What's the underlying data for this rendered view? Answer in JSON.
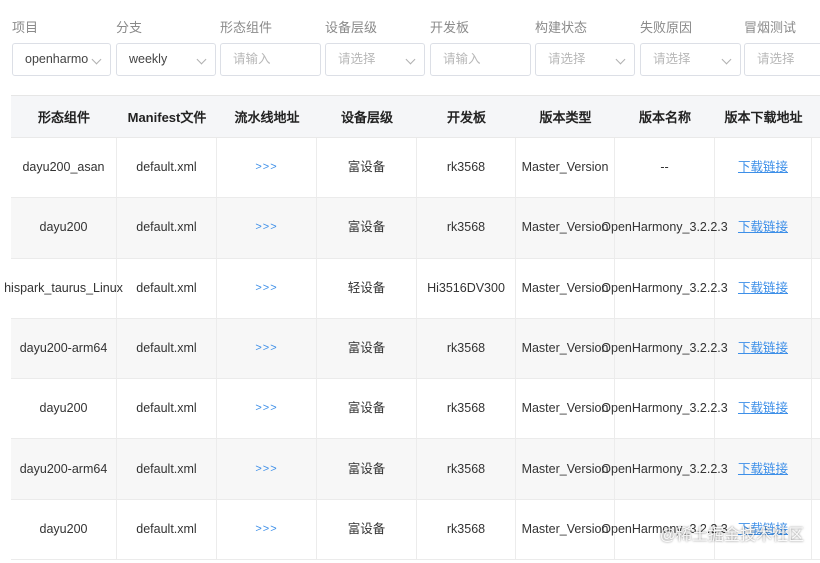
{
  "filters": [
    {
      "label": "项目",
      "value": "openharmo",
      "placeholder": "",
      "chevron": true
    },
    {
      "label": "分支",
      "value": "weekly",
      "placeholder": "",
      "chevron": true
    },
    {
      "label": "形态组件",
      "value": "",
      "placeholder": "请输入",
      "chevron": false
    },
    {
      "label": "设备层级",
      "value": "",
      "placeholder": "请选择",
      "chevron": true
    },
    {
      "label": "开发板",
      "value": "",
      "placeholder": "请输入",
      "chevron": false
    },
    {
      "label": "构建状态",
      "value": "",
      "placeholder": "请选择",
      "chevron": true
    },
    {
      "label": "失败原因",
      "value": "",
      "placeholder": "请选择",
      "chevron": true
    },
    {
      "label": "冒烟测试",
      "value": "",
      "placeholder": "请选择",
      "chevron": false
    }
  ],
  "table": {
    "headers": [
      "形态组件",
      "Manifest文件",
      "流水线地址",
      "设备层级",
      "开发板",
      "版本类型",
      "版本名称",
      "版本下载地址"
    ],
    "pipeline_link": ">>>",
    "download_link": "下载链接",
    "rows": [
      {
        "component": "dayu200_asan",
        "manifest": "default.xml",
        "level": "富设备",
        "board": "rk3568",
        "type": "Master_Version",
        "name": "--"
      },
      {
        "component": "dayu200",
        "manifest": "default.xml",
        "level": "富设备",
        "board": "rk3568",
        "type": "Master_Version",
        "name": "OpenHarmony_3.2.2.3"
      },
      {
        "component": "hispark_taurus_Linux",
        "manifest": "default.xml",
        "level": "轻设备",
        "board": "Hi3516DV300",
        "type": "Master_Version",
        "name": "OpenHarmony_3.2.2.3"
      },
      {
        "component": "dayu200-arm64",
        "manifest": "default.xml",
        "level": "富设备",
        "board": "rk3568",
        "type": "Master_Version",
        "name": "OpenHarmony_3.2.2.3"
      },
      {
        "component": "dayu200",
        "manifest": "default.xml",
        "level": "富设备",
        "board": "rk3568",
        "type": "Master_Version",
        "name": "OpenHarmony_3.2.2.3"
      },
      {
        "component": "dayu200-arm64",
        "manifest": "default.xml",
        "level": "富设备",
        "board": "rk3568",
        "type": "Master_Version",
        "name": "OpenHarmony_3.2.2.3"
      },
      {
        "component": "dayu200",
        "manifest": "default.xml",
        "level": "富设备",
        "board": "rk3568",
        "type": "Master_Version",
        "name": "OpenHarmony_3.2.2.3"
      }
    ]
  },
  "watermark": "@稀土掘金技术社区",
  "colors": {
    "link": "#3d8fe8",
    "header_bg": "#f5f6f8",
    "border": "#dcdfe6"
  }
}
